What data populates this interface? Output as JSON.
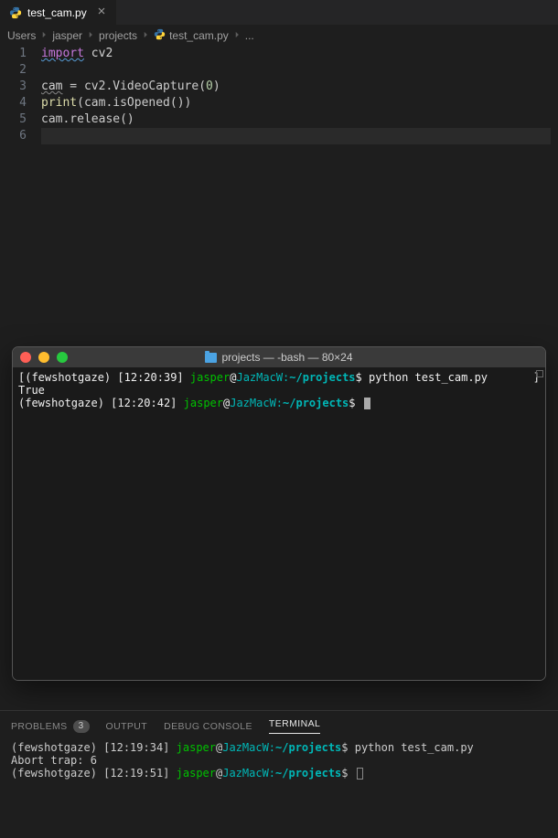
{
  "tab": {
    "filename": "test_cam.py"
  },
  "breadcrumb": {
    "parts": [
      "Users",
      "jasper",
      "projects",
      "test_cam.py",
      "..."
    ]
  },
  "editor": {
    "lines": [
      {
        "n": "1",
        "tokens": [
          [
            "import",
            "kw-wavy"
          ],
          [
            " ",
            ""
          ],
          [
            "cv2",
            "mod"
          ]
        ]
      },
      {
        "n": "2",
        "tokens": []
      },
      {
        "n": "3",
        "tokens": [
          [
            "cam",
            "var-wavy"
          ],
          [
            " = cv2.VideoCapture(",
            ""
          ],
          [
            "0",
            "num"
          ],
          [
            ")",
            ""
          ]
        ]
      },
      {
        "n": "4",
        "tokens": [
          [
            "print",
            "builtin"
          ],
          [
            "(cam.isOpened())",
            ""
          ]
        ]
      },
      {
        "n": "5",
        "tokens": [
          [
            "cam.release()",
            ""
          ]
        ]
      },
      {
        "n": "6",
        "tokens": [],
        "current": true
      }
    ]
  },
  "macTerminal": {
    "title": "projects — -bash — 80×24",
    "lines": [
      {
        "prefix": "[",
        "env": "(fewshotgaze)",
        "time": "[12:20:39]",
        "user": "jasper",
        "at": "@",
        "host": "JazMacW:",
        "path": "~/projects",
        "dollar": "$ ",
        "cmd": "python test_cam.py",
        "trail": "]"
      },
      {
        "plain": "True"
      },
      {
        "env": "(fewshotgaze)",
        "time": "[12:20:42]",
        "user": "jasper",
        "at": "@",
        "host": "JazMacW:",
        "path": "~/projects",
        "dollar": "$ ",
        "cmd": "",
        "cursor": "block"
      }
    ]
  },
  "panel": {
    "tabs": {
      "problems": "PROBLEMS",
      "problemsBadge": "3",
      "output": "OUTPUT",
      "debug": "DEBUG CONSOLE",
      "terminal": "TERMINAL"
    },
    "terminalLines": [
      {
        "env": "(fewshotgaze)",
        "time": "[12:19:34]",
        "user": "jasper",
        "at": "@",
        "host": "JazMacW:",
        "path": "~/projects",
        "dollar": "$ ",
        "cmd": "python test_cam.py"
      },
      {
        "plain": "Abort trap: 6"
      },
      {
        "env": "(fewshotgaze)",
        "time": "[12:19:51]",
        "user": "jasper",
        "at": "@",
        "host": "JazMacW:",
        "path": "~/projects",
        "dollar": "$ ",
        "cmd": "",
        "cursor": "outline"
      }
    ]
  }
}
